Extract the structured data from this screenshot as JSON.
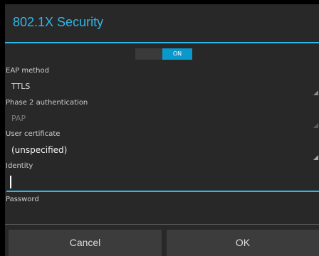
{
  "dialog": {
    "title": "802.1X Security",
    "toggle_label": "ON",
    "eap_method": {
      "label": "EAP method",
      "value": "TTLS"
    },
    "phase2": {
      "label": "Phase 2 authentication",
      "value": "PAP"
    },
    "user_cert": {
      "label": "User certificate",
      "value": "(unspecified)"
    },
    "identity": {
      "label": "Identity",
      "value": ""
    },
    "password": {
      "label": "Password",
      "value": ""
    },
    "cancel_label": "Cancel",
    "ok_label": "OK"
  },
  "colors": {
    "accent": "#33b5e5",
    "dialog_bg": "#282828",
    "button_bg": "#3c3c3c",
    "disabled_text": "#7a7a7a"
  }
}
